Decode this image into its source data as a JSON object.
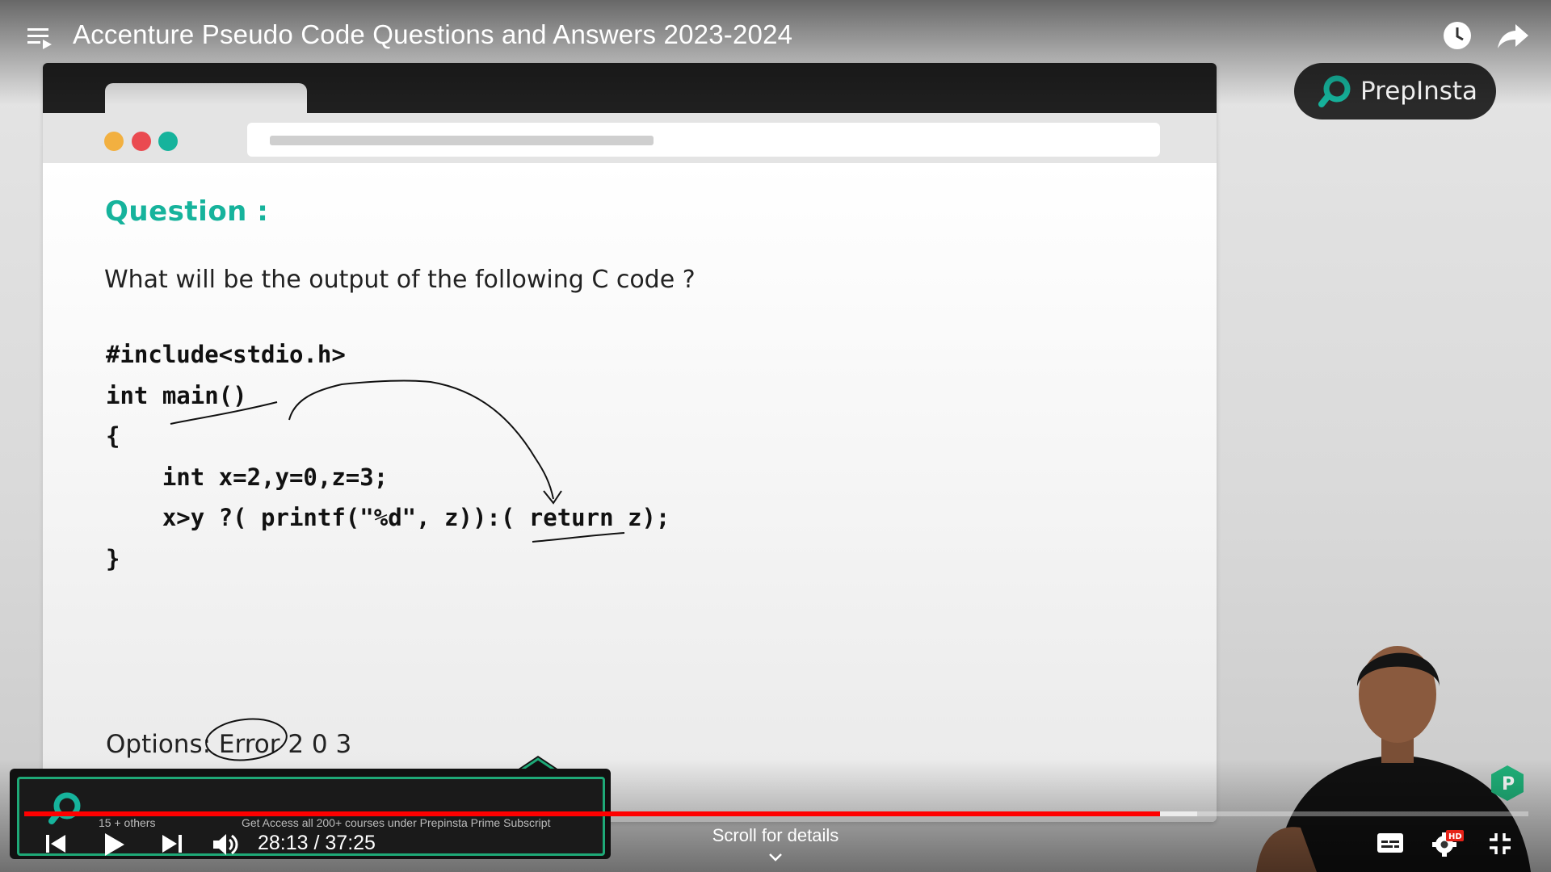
{
  "player": {
    "title": "Accenture Pseudo Code Questions and Answers 2023-2024",
    "time_display": "28:13 / 37:25",
    "progress_played": 0.7552,
    "progress_buffered": 0.78,
    "scroll_hint": "Scroll for details",
    "quality_badge": "HD",
    "icons": [
      "playlist-icon",
      "watch-later-icon",
      "share-icon",
      "previous-icon",
      "play-icon",
      "next-icon",
      "volume-icon",
      "captions-icon",
      "settings-icon",
      "exit-fullscreen-icon"
    ]
  },
  "brand": {
    "name": "PrepInsta",
    "accent": "#16b39c"
  },
  "slide": {
    "heading": "Question  :",
    "prompt": "What will be the output of the following C code ?",
    "code_lines": [
      "#include<stdio.h>",
      "int main()",
      "{",
      "    int x=2,y=0,z=3;",
      "    x>y ?( printf(\"%d\", z)):( return z);",
      "}"
    ],
    "options": "Options: Error  2  0 3"
  },
  "endscreen_card": {
    "line1": "15 + others",
    "line2": "Get Access all 200+ courses under Prepinsta Prime Subscript"
  }
}
